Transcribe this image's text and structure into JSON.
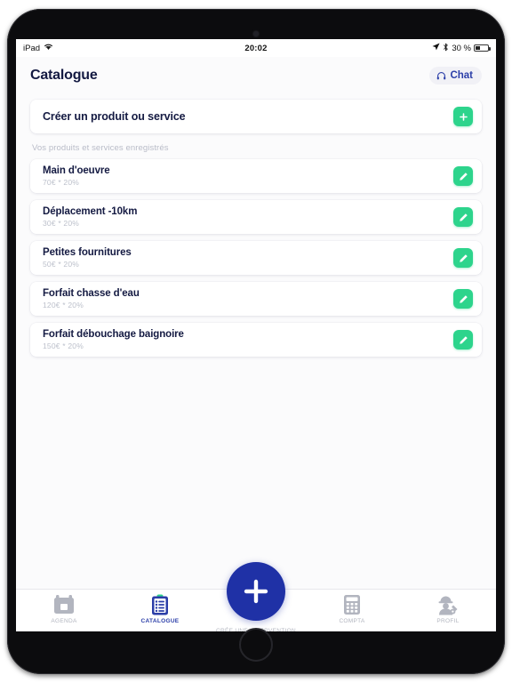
{
  "statusbar": {
    "device": "iPad",
    "wifi_icon": "wifi-icon",
    "time": "20:02",
    "location_icon": "location-arrow-icon",
    "bluetooth_icon": "bluetooth-icon",
    "battery_percent": "30 %",
    "battery_level": 30
  },
  "header": {
    "title": "Catalogue",
    "chat_label": "Chat",
    "chat_icon": "headset-icon"
  },
  "create": {
    "label": "Créer un produit ou service",
    "button_icon": "plus-icon"
  },
  "section": {
    "label": "Vos produits et services enregistrés"
  },
  "products": [
    {
      "name": "Main d'oeuvre",
      "price": "70€ * 20%",
      "edit_icon": "pencil-icon"
    },
    {
      "name": "Déplacement -10km",
      "price": "30€ * 20%",
      "edit_icon": "pencil-icon"
    },
    {
      "name": "Petites fournitures",
      "price": "50€ * 20%",
      "edit_icon": "pencil-icon"
    },
    {
      "name": "Forfait chasse d'eau",
      "price": "120€ * 20%",
      "edit_icon": "pencil-icon"
    },
    {
      "name": "Forfait débouchage baignoire",
      "price": "150€ * 20%",
      "edit_icon": "pencil-icon"
    }
  ],
  "tabs": [
    {
      "label": "AGENDA",
      "icon": "calendar-icon",
      "active": false
    },
    {
      "label": "CATALOGUE",
      "icon": "clipboard-icon",
      "active": true
    },
    {
      "label": "CRÉE UNE INTERVENTION",
      "icon": "plus-icon",
      "active": false
    },
    {
      "label": "COMPTA",
      "icon": "calculator-icon",
      "active": false
    },
    {
      "label": "PROFIL",
      "icon": "worker-icon",
      "active": false
    }
  ],
  "colors": {
    "accent_green": "#2dd48c",
    "accent_blue": "#1f31a6",
    "navy_text": "#141a42",
    "muted_text": "#b9bcc8",
    "screen_bg": "#fbfbfc"
  }
}
